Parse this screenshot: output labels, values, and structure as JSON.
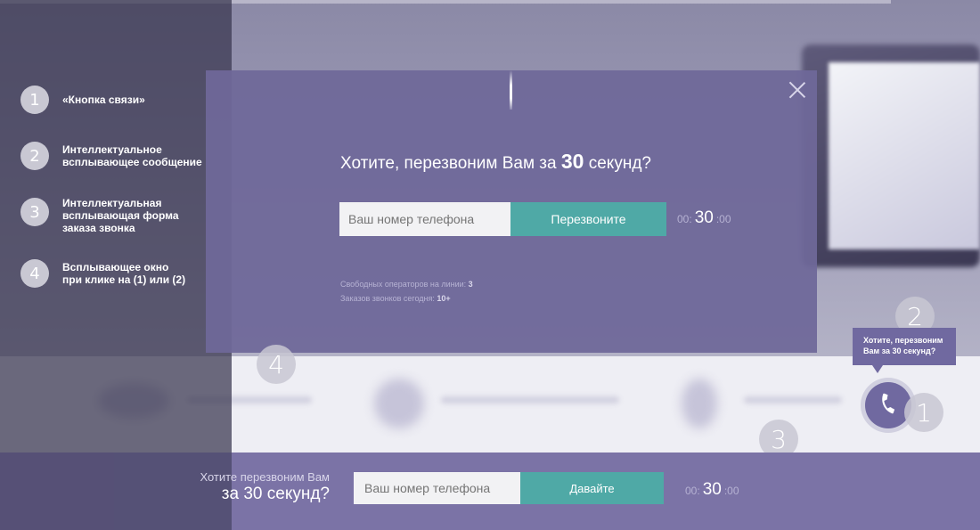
{
  "legend": [
    {
      "num": "1",
      "text": "«Кнопка связи»"
    },
    {
      "num": "2",
      "text": "Интеллектуальное\nвсплывающее сообщение"
    },
    {
      "num": "3",
      "text": "Интеллектуальная\nвсплывающая форма\nзаказа звонка"
    },
    {
      "num": "4",
      "text": "Всплывающее окно\nпри клике на (1) или (2)"
    }
  ],
  "modal": {
    "title_prefix": "Хотите, перезвоним Вам за",
    "title_number": "30",
    "title_suffix": "секунд?",
    "phone_placeholder": "Ваш номер телефона",
    "submit_label": "Перезвоните",
    "timer": {
      "min": "00:",
      "sec": "30",
      "ms": ":00"
    },
    "stats": {
      "operators_label": "Свободных операторов на линии:",
      "operators_value": "3",
      "orders_label": "Заказов звонков сегодня:",
      "orders_value": "10+"
    }
  },
  "badges": {
    "b1": "1",
    "b2": "2",
    "b3": "3",
    "b4": "4"
  },
  "tooltip": {
    "text": "Хотите, перезвоним Вам за 30 секунд?"
  },
  "bottom_bar": {
    "title_line1": "Хотите перезвоним Вам",
    "title_line2": "за 30 секунд?",
    "phone_placeholder": "Ваш номер телефона",
    "submit_label": "Давайте",
    "timer": {
      "min": "00:",
      "sec": "30",
      "ms": ":00"
    }
  },
  "colors": {
    "accent": "#4fa9a6",
    "modal_bg": "#6f6899",
    "bar_bg": "#7b73a6"
  },
  "icons": {
    "call": "phone-icon",
    "close": "close-icon"
  }
}
